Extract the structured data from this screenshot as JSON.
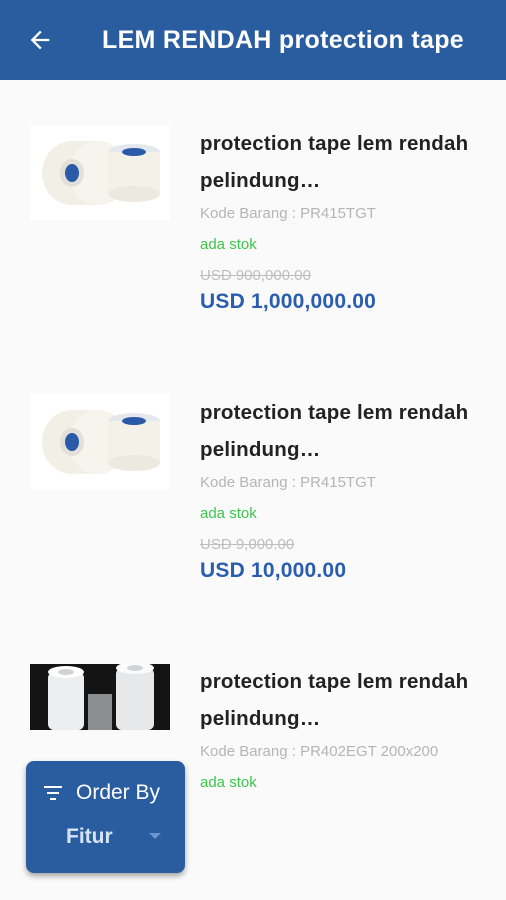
{
  "header": {
    "back_icon": "arrow-left-icon",
    "title": "LEM RENDAH protection tape"
  },
  "products": [
    {
      "name": "protection tape lem rendah pelindung…",
      "code": "Kode Barang : PR415TGT",
      "stock": "ada stok",
      "old_price": "USD 900,000.00",
      "price": "USD 1,000,000.00",
      "image": "tape-rolls-image"
    },
    {
      "name": "protection tape lem rendah pelindung…",
      "code": "Kode Barang : PR415TGT",
      "stock": "ada stok",
      "old_price": "USD 9,000.00",
      "price": "USD 10,000.00",
      "image": "tape-rolls-image"
    },
    {
      "name": "protection tape lem rendah pelindung…",
      "code": "Kode Barang : PR402EGT 200x200",
      "stock": "ada stok",
      "image": "film-rolls-image"
    }
  ],
  "order_by": {
    "icon": "sort-icon",
    "label": "Order By",
    "value": "Fitur",
    "caret_icon": "caret-down-icon"
  },
  "colors": {
    "primary": "#2a5d9f",
    "stock_green": "#3cc54d",
    "price_blue": "#2a5db0"
  }
}
